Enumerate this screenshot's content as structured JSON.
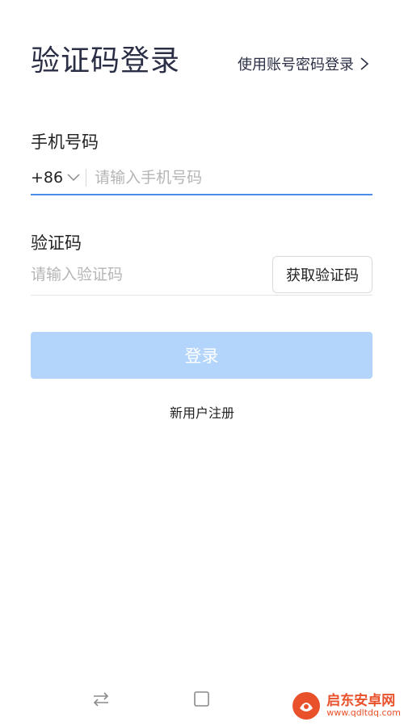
{
  "header": {
    "title": "验证码登录",
    "switch_link": "使用账号密码登录"
  },
  "phone": {
    "label": "手机号码",
    "country_code": "+86",
    "placeholder": "请输入手机号码",
    "value": ""
  },
  "code": {
    "label": "验证码",
    "placeholder": "请输入验证码",
    "value": "",
    "get_code_label": "获取验证码"
  },
  "login_button": "登录",
  "register_link": "新用户注册",
  "watermark": {
    "title": "启东安卓网",
    "url": "www.qdltdq.com"
  },
  "colors": {
    "accent": "#4a8de8",
    "login_disabled": "#b3d4fb",
    "title_text": "#2b2f45",
    "watermark": "#e8512a"
  }
}
